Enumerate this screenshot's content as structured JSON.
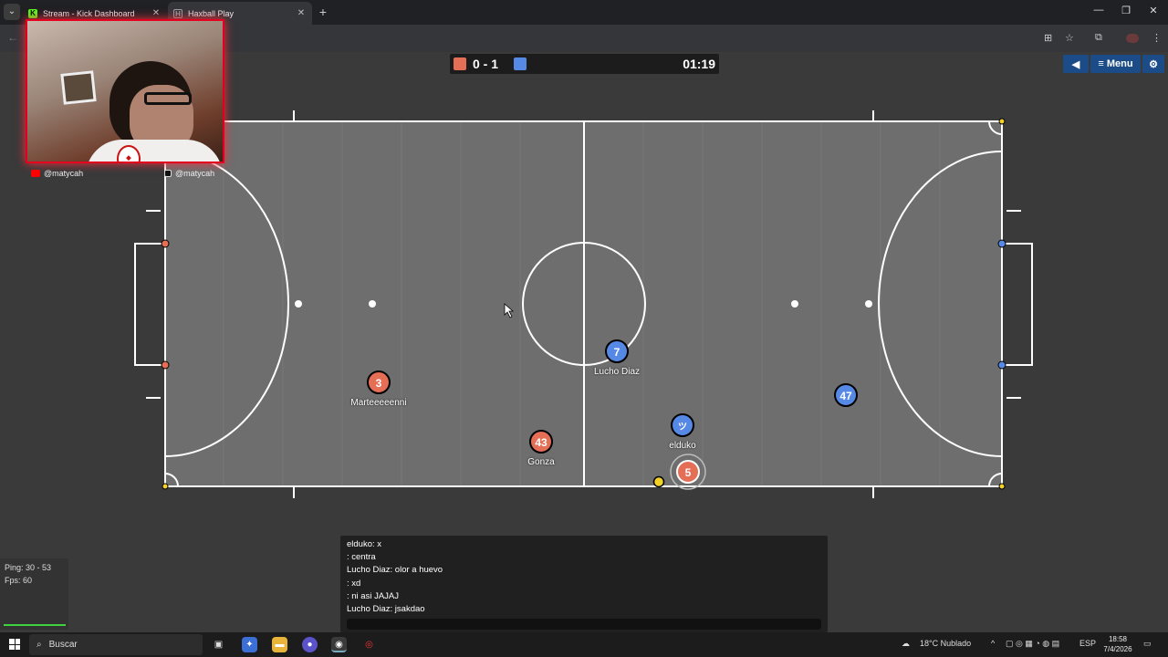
{
  "browser": {
    "tabs": [
      {
        "label": "Stream - Kick Dashboard",
        "favicon": "kick-icon",
        "color": "#53fc18",
        "active": false
      },
      {
        "label": "Haxball Play",
        "favicon": "haxball-icon",
        "color": "#9aa0a6",
        "active": true
      }
    ]
  },
  "scoreboard": {
    "score": "0 - 1",
    "time": "01:19",
    "red_color": "#e56e56",
    "blue_color": "#5689e5"
  },
  "menu": {
    "label": "Menu"
  },
  "overlay": {
    "youtube_handle": "@matycah",
    "tiktok_handle": "@matycah"
  },
  "players": [
    {
      "team": "red",
      "number": "3",
      "name": "Marteeeeenni"
    },
    {
      "team": "red",
      "number": "43",
      "name": "Gonza"
    },
    {
      "team": "red",
      "number": "5",
      "name": ""
    },
    {
      "team": "blue",
      "number": "7",
      "name": "Lucho Diaz"
    },
    {
      "team": "blue",
      "number": "ツ",
      "name": "elduko"
    },
    {
      "team": "blue",
      "number": "47",
      "name": ""
    }
  ],
  "stats": {
    "ping": "Ping: 30 - 53",
    "fps": "Fps: 60"
  },
  "chat": {
    "messages": [
      "elduko: x",
      ": centra",
      "Lucho Diaz: olor a huevo",
      ": xd",
      ": ni asi JAJAJ",
      "Lucho Diaz: jsakdao"
    ]
  },
  "taskbar": {
    "search_placeholder": "Buscar",
    "weather": "18°C  Nublado",
    "language": "ESP",
    "time": "18:58",
    "date": "7/4/2026"
  }
}
